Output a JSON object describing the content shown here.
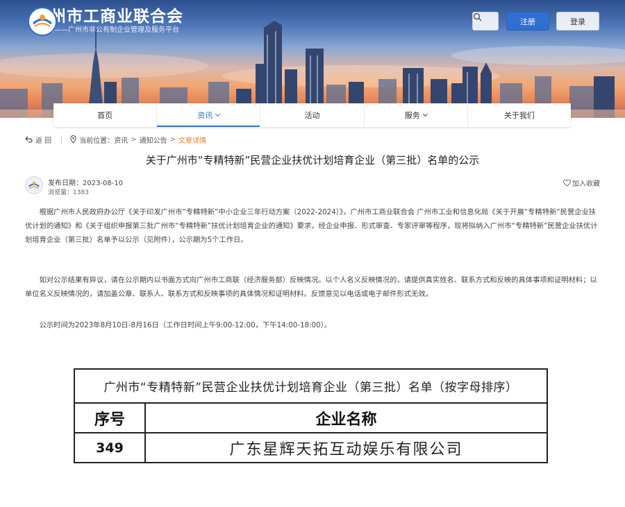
{
  "header": {
    "site_title": "广州市工商业联合会",
    "site_subtitle": "穗企通——广州市非公有制企业管理及服务平台",
    "register_label": "注册",
    "login_label": "登录"
  },
  "nav": {
    "items": [
      {
        "label": "首页"
      },
      {
        "label": "资讯"
      },
      {
        "label": "活动"
      },
      {
        "label": "服务"
      },
      {
        "label": "关于我们"
      }
    ]
  },
  "breadcrumb": {
    "back_label": "返 回",
    "prefix": "当前位置：",
    "items": [
      "资讯",
      "通知公告",
      "文章详情"
    ]
  },
  "article": {
    "title": "关于广州市“专精特新”民营企业扶优计划培育企业（第三批）名单的公示",
    "date": "发布日期：2023-08-10",
    "views": "浏览量：1383",
    "favorite_label": "加入收藏",
    "paragraphs": [
      "根据广州市人民政府办公厅《关于印发广州市“专精特新”中小企业三年行动方案（2022-2024）》，广州市工商业联合会 广州市工业和信息化局《关于开展“专精特新”民营企业扶优计划的通知》和《关于组织申报第三批广州市“专精特新”扶优计划培育企业的通知》要求，经企业申报、形式审查、专家评审等程序，现将拟纳入广州市“专精特新”民营企业扶优计划培育企业（第三批）名单予以公示（见附件），公示期为5个工作日。",
      "如对公示结果有异议，请在公示期内以书面方式向广州市工商联（经济服务部）反映情况。以个人名义反映情况的，请提供真实姓名、联系方式和反映的具体事项和证明材料；以单位名义反映情况的，请加盖公章、联系人、联系方式和反映事项的具体情况和证明材料。反馈意见以电话或电子邮件形式无效。",
      "公示时间为2023年8月10日-8月16日（工作日时间上午9:00-12:00，下午14:00-18:00）。"
    ]
  },
  "attachment": {
    "caption": "广州市“专精特新”民营企业扶优计划培育企业（第三批）名单（按字母排序）",
    "col_index": "序号",
    "col_name": "企业名称",
    "rows": [
      {
        "index": "349",
        "name": "广东星辉天拓互动娱乐有限公司"
      }
    ]
  },
  "colors": {
    "accent": "#2f6fd0",
    "current_crumb": "#e37f22"
  },
  "icons": [
    "logo-emblem",
    "search-icon",
    "back-icon",
    "location-icon",
    "heart-icon",
    "avatar"
  ]
}
